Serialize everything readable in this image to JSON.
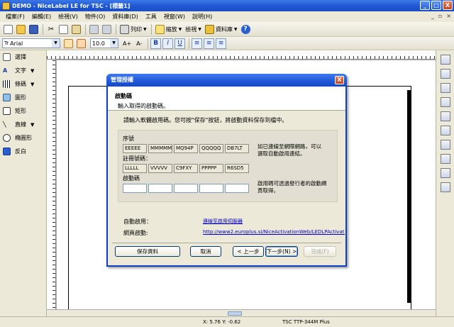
{
  "window": {
    "title": "DEMO - NiceLabel LE for TSC - [標籤1]",
    "minimize": "_",
    "maximize": "□",
    "close": "X"
  },
  "menu": {
    "items": [
      "檔案(F)",
      "編輯(E)",
      "檢視(V)",
      "物件(O)",
      "資料庫(D)",
      "工具",
      "視窗(W)",
      "說明(H)"
    ]
  },
  "toolbar1": {
    "print_label": "列印",
    "zoom_label": "縮放",
    "check_label": "檢視",
    "database_label": "資料庫",
    "help_label": "?"
  },
  "toolbar2": {
    "font_name": "Arial",
    "font_size": "10.0",
    "bold": "B",
    "italic": "I",
    "underline": "U",
    "grow_font": "A+",
    "shrink_font": "A-"
  },
  "left_tools": [
    {
      "label": "選擇"
    },
    {
      "label": "文字"
    },
    {
      "label": "條碼"
    },
    {
      "label": "圖形"
    },
    {
      "label": "矩形"
    },
    {
      "label": "直線"
    },
    {
      "label": "橢圓形"
    },
    {
      "label": "反白"
    }
  ],
  "dialog": {
    "title": "管理授權",
    "close": "X",
    "header_title": "啟動碼",
    "header_subtitle": "輸入取得的啟動碼。",
    "instruction": "請輸入軟體啟用碼。您可按\"保存\"按鈕，將啟動資料保存到檔中。",
    "serial_label": "序號",
    "serial_parts": [
      "EEEEE",
      "MMMMM",
      "MQ94P",
      "QQQQQ",
      "DB7LT"
    ],
    "reg_label": "註冊號碼：",
    "reg_parts": [
      "LLLLL",
      "VVVVV",
      "C9FXY",
      "PPPPP",
      "R6SD5"
    ],
    "activation_label": "啟動碼",
    "activation_parts": [
      "",
      "",
      "",
      "",
      ""
    ],
    "note_online": "如已連線至網際網路，可以\n選取自動啟用連結。",
    "note_dealer": "啟用碼可透過發行者的啟動網\n頁取得。",
    "auto_label": "自動啟用：",
    "auto_link": "連線至啟用伺服器",
    "web_label": "網頁啟動:",
    "web_link": "http://www2.europlus.si/NiceActivationWeb/LEDLPActivation.aspx",
    "btn_save": "保存資料",
    "btn_cancel": "取消",
    "btn_back": "< 上一步",
    "btn_next": "下一步(N) >",
    "btn_finish": "完成(F)"
  },
  "status": {
    "coords": "X: 5.76 Y: -0.62",
    "printer": "TSC  TTP-344M Plus"
  }
}
